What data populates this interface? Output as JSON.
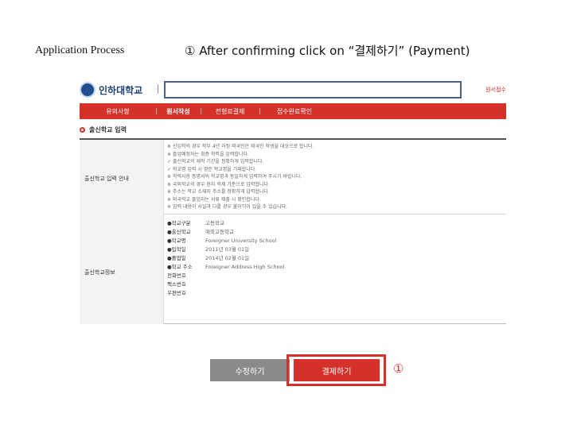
{
  "slide": {
    "process_label": "Application Process",
    "step_title": "① After confirming click on “결제하기” (Payment)",
    "marker": "①"
  },
  "portal": {
    "brand_name": "인하대학교",
    "top_link": "원서접수",
    "nav": [
      "유의사항",
      "원서작성",
      "전형료결제",
      "접수완료확인"
    ],
    "nav_active_index": 1,
    "section_title": "출신학교 입력",
    "left_labels": [
      "출신학교 입력 안내",
      "출신학교정보"
    ],
    "notes": [
      "※ 신입학의 경우 학부 4년 과정 외국인은 외국인 학생을 대상으로 합니다.",
      "   ※ 졸업예정자는 최종 학력을 입력합니다.",
      "✓ 출신학교의 재학 기간을 정확하게 입력합니다.",
      "✓ 학교명 입력 시 영문 학교명을 기재합니다.",
      "※ 학력사항 증명서의 학교명과 동일하게 입력하여 주시기 바랍니다.",
      "※ 국외학교의 경우 현지 학제 기준으로 입력합니다.",
      "※ 주소는 학교 소재지 주소를 정확하게 입력합니다.",
      "※ 외국학교 졸업자는 서류 제출 시 확인합니다.",
      "※ 입력 내용이 사실과 다를 경우 불이익이 있을 수 있습니다."
    ],
    "fields": [
      {
        "key": "●학교구분",
        "value": "고등학교"
      },
      {
        "key": "●출신학교",
        "value": "해외고등학교"
      },
      {
        "key": "●학교명",
        "value": "Foreigner University School"
      },
      {
        "key": "●입학일",
        "value": "2011년 03월 01일"
      },
      {
        "key": "●졸업일",
        "value": "2014년 02월 01일"
      },
      {
        "key": "●학교 주소",
        "value": "Foreigner Address High School"
      },
      {
        "key": "전화번호",
        "value": ""
      },
      {
        "key": "팩스번호",
        "value": ""
      },
      {
        "key": "우편번호",
        "value": ""
      }
    ],
    "buttons": {
      "edit": "수정하기",
      "pay": "결제하기"
    }
  },
  "colors": {
    "accent": "#d4312a",
    "brand": "#1d3f73",
    "button_gray": "#8a8a8a"
  }
}
